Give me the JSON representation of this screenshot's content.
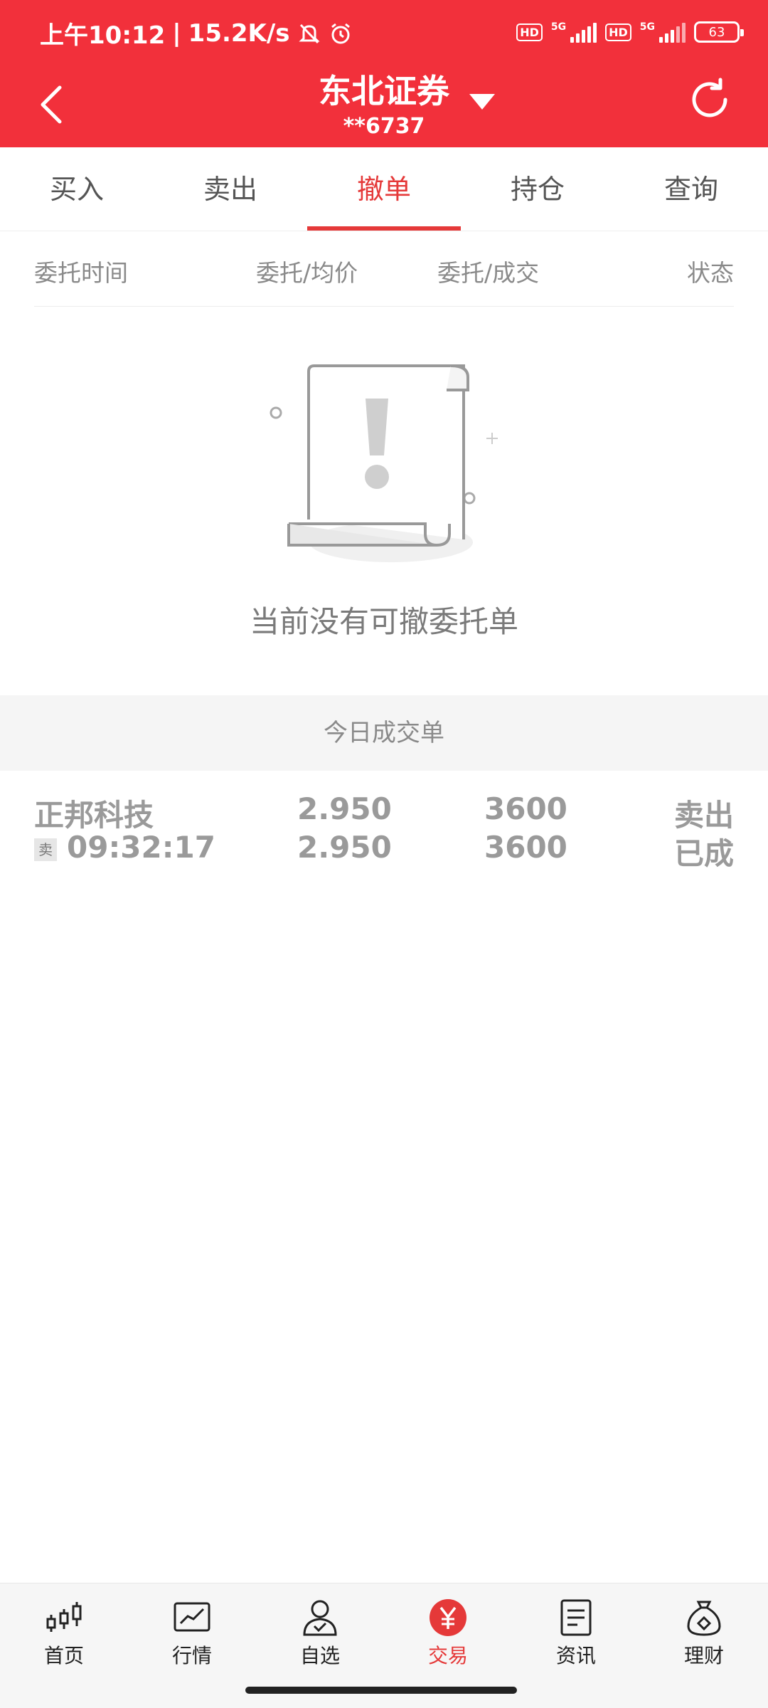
{
  "status_bar": {
    "time": "上午10:12",
    "net_speed": "15.2K/s",
    "icons": [
      "mute-icon",
      "alarm-icon"
    ],
    "hd_label": "HD",
    "network_label": "5G",
    "battery": "63"
  },
  "header": {
    "title": "东北证券",
    "account": "**6737",
    "back_icon": "chevron-left-icon",
    "refresh_icon": "refresh-icon"
  },
  "tabs": [
    {
      "label": "买入",
      "active": false
    },
    {
      "label": "卖出",
      "active": false
    },
    {
      "label": "撤单",
      "active": true
    },
    {
      "label": "持仓",
      "active": false
    },
    {
      "label": "查询",
      "active": false
    }
  ],
  "columns": {
    "time": "委托时间",
    "price": "委托/均价",
    "qty": "委托/成交",
    "status": "状态"
  },
  "empty_state": {
    "message": "当前没有可撤委托单",
    "icon": "empty-document-icon"
  },
  "today_deals": {
    "title": "今日成交单",
    "rows": [
      {
        "name": "正邦科技",
        "side_tag": "卖",
        "time": "09:32:17",
        "order_price": "2.950",
        "avg_price": "2.950",
        "order_qty": "3600",
        "deal_qty": "3600",
        "direction": "卖出",
        "status": "已成"
      }
    ]
  },
  "bottom_nav": [
    {
      "label": "首页",
      "icon": "candlestick-icon",
      "active": false
    },
    {
      "label": "行情",
      "icon": "chart-icon",
      "active": false
    },
    {
      "label": "自选",
      "icon": "user-check-icon",
      "active": false
    },
    {
      "label": "交易",
      "icon": "yen-icon",
      "active": true
    },
    {
      "label": "资讯",
      "icon": "document-icon",
      "active": false
    },
    {
      "label": "理财",
      "icon": "money-bag-icon",
      "active": false
    }
  ],
  "colors": {
    "brand_red": "#f2303b",
    "active_red": "#e53939"
  }
}
